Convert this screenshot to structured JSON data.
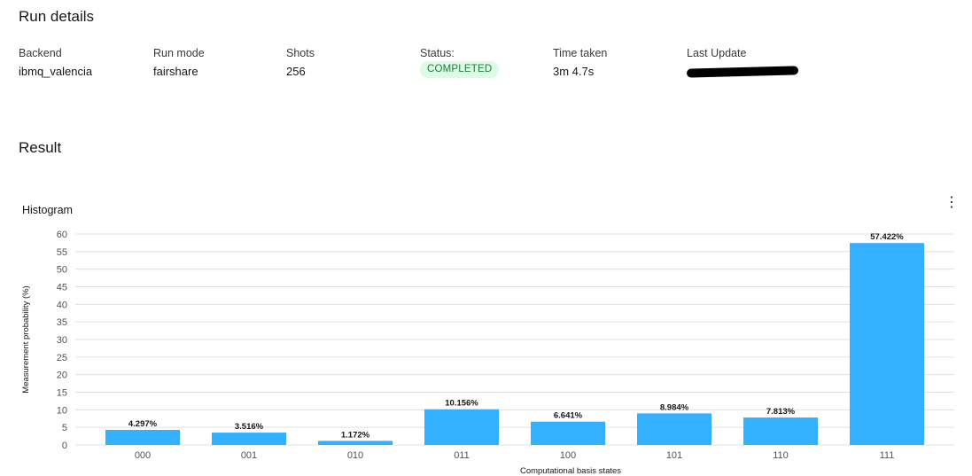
{
  "run_details": {
    "title": "Run details",
    "fields": {
      "backend": {
        "label": "Backend",
        "value": "ibmq_valencia"
      },
      "run_mode": {
        "label": "Run mode",
        "value": "fairshare"
      },
      "shots": {
        "label": "Shots",
        "value": "256"
      },
      "status": {
        "label": "Status:",
        "value": "COMPLETED"
      },
      "time_taken": {
        "label": "Time taken",
        "value": "3m 4.7s"
      },
      "last_update": {
        "label": "Last Update"
      }
    }
  },
  "result": {
    "title": "Result",
    "histogram_title": "Histogram",
    "menu_icon": "overflow-menu-vertical-icon"
  },
  "colors": {
    "bar": "#33b1ff",
    "status_bg": "#defbe6",
    "status_text": "#198038",
    "grid": "#e0e0e0"
  },
  "chart_data": {
    "type": "bar",
    "categories": [
      "000",
      "001",
      "010",
      "011",
      "100",
      "101",
      "110",
      "111"
    ],
    "values": [
      4.297,
      3.516,
      1.172,
      10.156,
      6.641,
      8.984,
      7.813,
      57.422
    ],
    "data_labels": [
      "4.297%",
      "3.516%",
      "1.172%",
      "10.156%",
      "6.641%",
      "8.984%",
      "7.813%",
      "57.422%"
    ],
    "xlabel": "Computational basis states",
    "ylabel": "Measurement probability (%)",
    "ylim": [
      0,
      60
    ],
    "yticks": [
      0,
      5,
      10,
      15,
      20,
      25,
      30,
      35,
      40,
      45,
      50,
      55,
      60
    ],
    "grid": true
  }
}
